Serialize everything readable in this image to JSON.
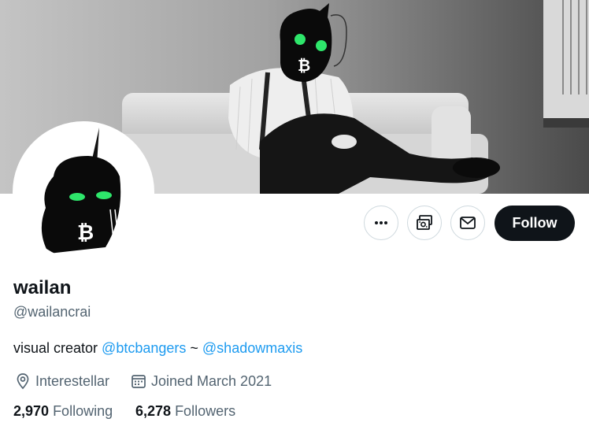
{
  "profile": {
    "display_name": "wailan",
    "handle": "@wailancrai",
    "bio": {
      "prefix": "visual creator ",
      "mention1": "@btcbangers",
      "separator": " ~ ",
      "mention2": "@shadowmaxis"
    },
    "location": "Interestellar",
    "joined": "Joined March 2021",
    "following": {
      "count": "2,970",
      "label": "Following"
    },
    "followers": {
      "count": "6,278",
      "label": "Followers"
    }
  },
  "actions": {
    "follow_label": "Follow",
    "more_icon": "more-icon",
    "subscribe_icon": "subscribe-icon",
    "message_icon": "envelope-icon"
  },
  "colors": {
    "primary_text": "#0f1419",
    "secondary_text": "#536471",
    "link": "#1d9bf0",
    "follow_button_bg": "#0f1419",
    "avatar_eyes": "#2ee66b"
  }
}
